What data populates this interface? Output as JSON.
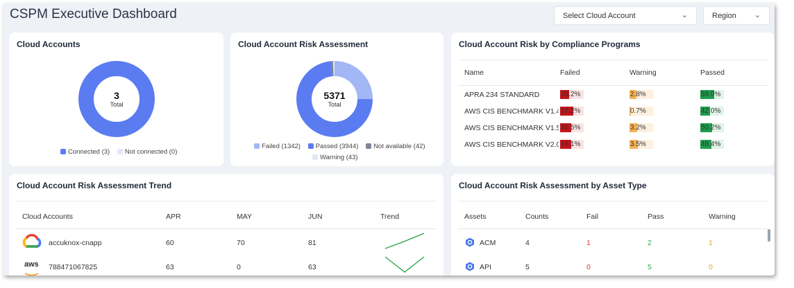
{
  "header": {
    "title": "CSPM Executive Dashboard",
    "account_select": "Select Cloud Account",
    "region_select": "Region"
  },
  "colors": {
    "connected": "#5b7cf0",
    "failed": "#a3b7f7",
    "passed": "#5b7cf0",
    "not_available": "#7e8595",
    "warning": "#e3e8f7",
    "fail_bar": "#c0161b",
    "warn_bar": "#f6b256",
    "pass_bar": "#1f9d4c"
  },
  "cloud_accounts": {
    "title": "Cloud Accounts",
    "total": "3",
    "total_label": "Total",
    "legend": [
      {
        "label": "Connected (3)",
        "color": "#5b7cf0"
      },
      {
        "label": "Not connected (0)",
        "color": "#e3e8f7"
      }
    ],
    "chart_data": {
      "type": "pie",
      "labels": [
        "Connected",
        "Not connected"
      ],
      "values": [
        3,
        0
      ]
    }
  },
  "risk_assessment": {
    "title": "Cloud Account Risk Assessment",
    "total": "5371",
    "total_label": "Total",
    "legend_row1": [
      {
        "label": "Failed (1342)",
        "color": "#a3b7f7"
      },
      {
        "label": "Passed (3944)",
        "color": "#5b7cf0"
      },
      {
        "label": "Not available (42)",
        "color": "#7e8595"
      }
    ],
    "legend_row2": [
      {
        "label": "Warning (43)",
        "color": "#e3e8f7"
      }
    ],
    "chart_data": {
      "type": "pie",
      "labels": [
        "Failed",
        "Passed",
        "Not available",
        "Warning"
      ],
      "values": [
        1342,
        3944,
        42,
        43
      ]
    }
  },
  "compliance": {
    "title": "Cloud Account Risk by Compliance Programs",
    "headers": [
      "Name",
      "Failed",
      "Warning",
      "Passed"
    ],
    "rows": [
      {
        "name": "APRA 234 STANDARD",
        "failed": "38.2%",
        "warning": "2.8%",
        "passed": "59.0%",
        "f": 38.2,
        "w": 2.8,
        "p": 59.0
      },
      {
        "name": "AWS CIS BENCHMARK V1.4.0",
        "failed": "57.2%",
        "warning": "0.7%",
        "passed": "42.0%",
        "f": 57.2,
        "w": 0.7,
        "p": 42.0
      },
      {
        "name": "AWS CIS BENCHMARK V1.5.0",
        "failed": "46.5%",
        "warning": "3.2%",
        "passed": "50.2%",
        "f": 46.5,
        "w": 3.2,
        "p": 50.2
      },
      {
        "name": "AWS CIS BENCHMARK V2.0.0",
        "failed": "48.1%",
        "warning": "3.5%",
        "passed": "48.4%",
        "f": 48.1,
        "w": 3.5,
        "p": 48.4
      }
    ]
  },
  "trend": {
    "title": "Cloud Account Risk Assessment Trend",
    "headers": [
      "Cloud Accounts",
      "APR",
      "MAY",
      "JUN",
      "Trend"
    ],
    "rows": [
      {
        "account": "accuknox-cnapp",
        "icon": "google-cloud-icon",
        "apr": "60",
        "may": "70",
        "jun": "81",
        "values": [
          60,
          70,
          81
        ]
      },
      {
        "account": "788471067825",
        "icon": "aws-icon",
        "icon_text": "aws",
        "apr": "63",
        "may": "0",
        "jun": "63",
        "values": [
          63,
          0,
          63
        ]
      }
    ]
  },
  "asset_type": {
    "title": "Cloud Account Risk Assessment by Asset Type",
    "headers": [
      "Assets",
      "Counts",
      "Fail",
      "Pass",
      "Warning"
    ],
    "rows": [
      {
        "asset": "ACM",
        "icon": "gcp-hexagon-icon",
        "counts": "4",
        "fail": "1",
        "pass": "2",
        "warning": "1"
      },
      {
        "asset": "API",
        "icon": "gcp-hexagon-icon",
        "counts": "5",
        "fail": "0",
        "pass": "5",
        "warning": "0"
      }
    ]
  }
}
